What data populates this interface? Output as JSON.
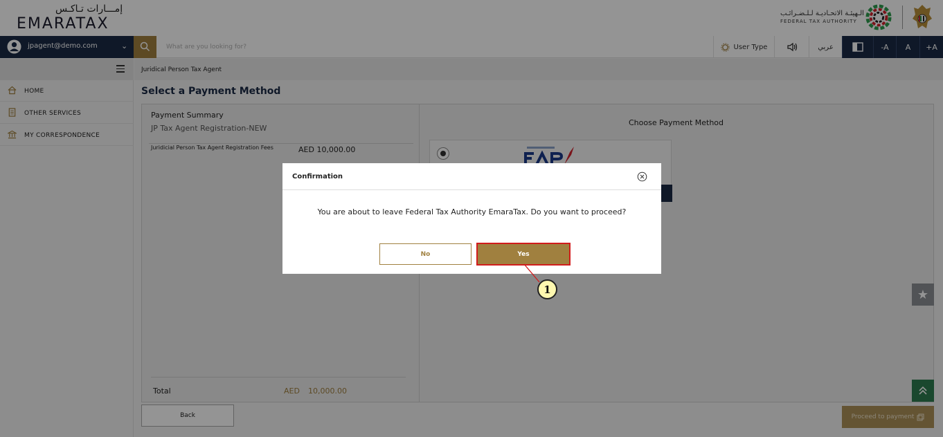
{
  "header": {
    "logo_arabic": "إمـــارات تـاكـس",
    "logo_english": "EMARATAX",
    "fta_arabic": "الـهيئـة الاتحـاديـة لـلـضـرائـب",
    "fta_english": "FEDERAL TAX AUTHORITY"
  },
  "topbar": {
    "user_email": "jpagent@demo.com",
    "search_placeholder": "What are you looking for?",
    "user_type_label": "User Type",
    "arabic_label": "عربي",
    "font_decrease": "-A",
    "font_normal": "A",
    "font_increase": "+A"
  },
  "sidebar": {
    "items": [
      {
        "label": "HOME",
        "icon": "home-icon"
      },
      {
        "label": "OTHER SERVICES",
        "icon": "document-icon"
      },
      {
        "label": "MY CORRESPONDENCE",
        "icon": "bank-icon"
      }
    ]
  },
  "main": {
    "breadcrumb": "Juridical Person Tax Agent",
    "page_title": "Select a Payment Method",
    "summary": {
      "title": "Payment Summary",
      "subtitle": "JP Tax Agent Registration-NEW",
      "row_label": "Juridicial Person Tax Agent Registration Fees",
      "row_value": "AED 10,000.00",
      "total_label": "Total",
      "total_currency": "AED",
      "total_value": "10,000.00"
    },
    "method": {
      "title": "Choose Payment Method"
    },
    "back_label": "Back",
    "proceed_label": "Proceed to payment"
  },
  "modal": {
    "title": "Confirmation",
    "message": "You are about to leave Federal Tax Authority EmaraTax. Do you want to proceed?",
    "no_label": "No",
    "yes_label": "Yes"
  },
  "annotation": {
    "step": "1"
  },
  "colors": {
    "navy": "#1b2a45",
    "gold": "#a0803f",
    "highlight_red": "#d11b1b",
    "green": "#2e7d50"
  }
}
